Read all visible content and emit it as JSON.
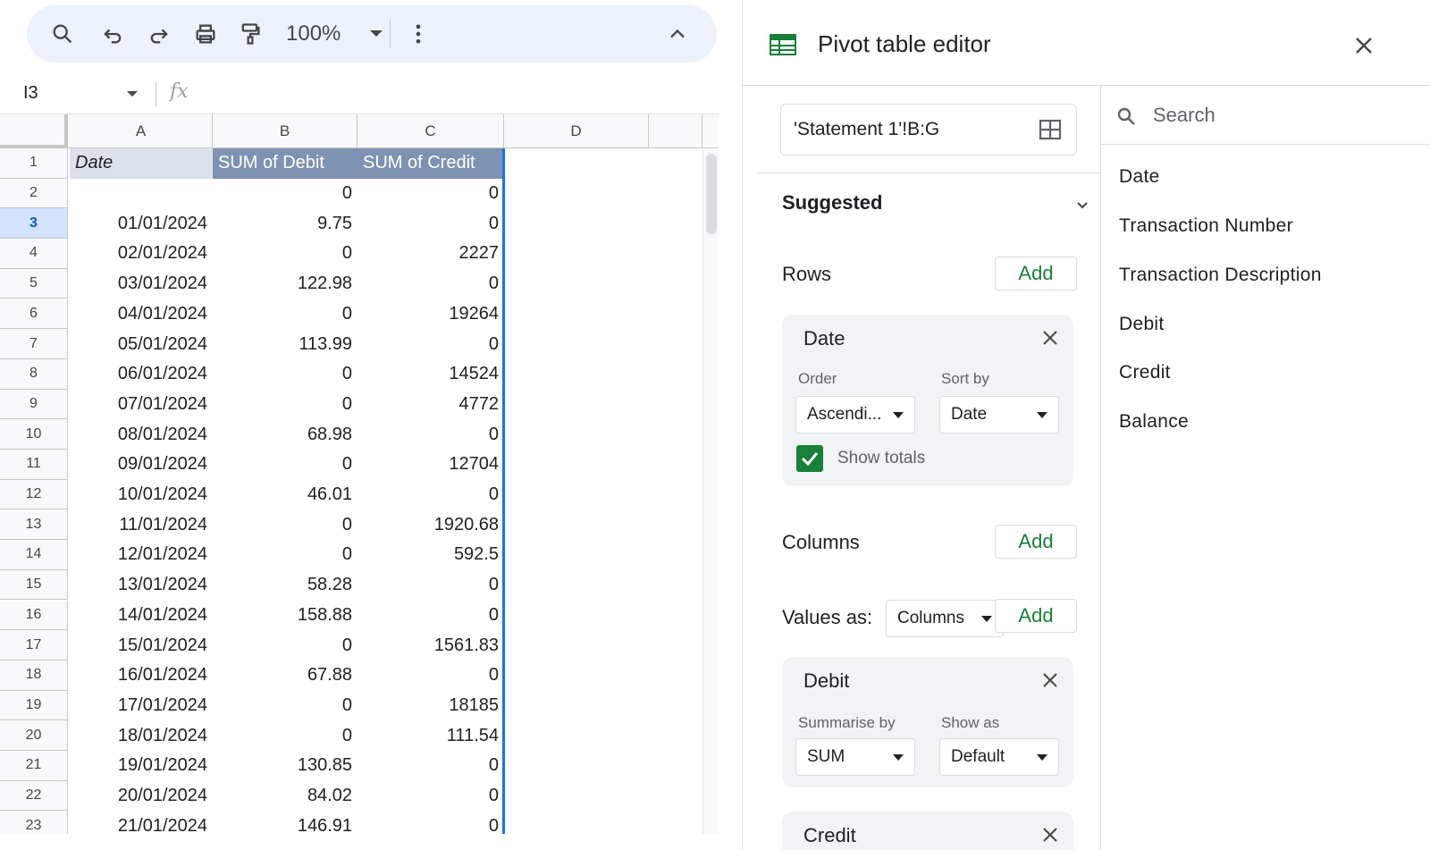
{
  "toolbar": {
    "zoom": "100%",
    "icons": [
      "search-icon",
      "undo-icon",
      "redo-icon",
      "print-icon",
      "paint-format-icon",
      "more-vert-icon",
      "chevron-up-icon"
    ]
  },
  "formula_bar": {
    "cell_ref": "I3",
    "fx": "fx"
  },
  "grid": {
    "columns": [
      "A",
      "B",
      "C",
      "D"
    ],
    "selected_row": "3",
    "header": {
      "row": "1",
      "a": "Date",
      "b": "SUM of Debit",
      "c": "SUM of Credit"
    },
    "rows": [
      {
        "num": "2",
        "a": "",
        "b": "0",
        "c": "0"
      },
      {
        "num": "3",
        "a": "01/01/2024",
        "b": "9.75",
        "c": "0"
      },
      {
        "num": "4",
        "a": "02/01/2024",
        "b": "0",
        "c": "2227"
      },
      {
        "num": "5",
        "a": "03/01/2024",
        "b": "122.98",
        "c": "0"
      },
      {
        "num": "6",
        "a": "04/01/2024",
        "b": "0",
        "c": "19264"
      },
      {
        "num": "7",
        "a": "05/01/2024",
        "b": "113.99",
        "c": "0"
      },
      {
        "num": "8",
        "a": "06/01/2024",
        "b": "0",
        "c": "14524"
      },
      {
        "num": "9",
        "a": "07/01/2024",
        "b": "0",
        "c": "4772"
      },
      {
        "num": "10",
        "a": "08/01/2024",
        "b": "68.98",
        "c": "0"
      },
      {
        "num": "11",
        "a": "09/01/2024",
        "b": "0",
        "c": "12704"
      },
      {
        "num": "12",
        "a": "10/01/2024",
        "b": "46.01",
        "c": "0"
      },
      {
        "num": "13",
        "a": "11/01/2024",
        "b": "0",
        "c": "1920.68"
      },
      {
        "num": "14",
        "a": "12/01/2024",
        "b": "0",
        "c": "592.5"
      },
      {
        "num": "15",
        "a": "13/01/2024",
        "b": "58.28",
        "c": "0"
      },
      {
        "num": "16",
        "a": "14/01/2024",
        "b": "158.88",
        "c": "0"
      },
      {
        "num": "17",
        "a": "15/01/2024",
        "b": "0",
        "c": "1561.83"
      },
      {
        "num": "18",
        "a": "16/01/2024",
        "b": "67.88",
        "c": "0"
      },
      {
        "num": "19",
        "a": "17/01/2024",
        "b": "0",
        "c": "18185"
      },
      {
        "num": "20",
        "a": "18/01/2024",
        "b": "0",
        "c": "111.54"
      },
      {
        "num": "21",
        "a": "19/01/2024",
        "b": "130.85",
        "c": "0"
      },
      {
        "num": "22",
        "a": "20/01/2024",
        "b": "84.02",
        "c": "0"
      },
      {
        "num": "23",
        "a": "21/01/2024",
        "b": "146.91",
        "c": "0"
      }
    ]
  },
  "editor": {
    "title": "Pivot table editor",
    "range": "'Statement 1'!B:G",
    "suggested": "Suggested",
    "rows_label": "Rows",
    "columns_label": "Columns",
    "values_as_label": "Values as:",
    "values_as_value": "Columns",
    "add_label": "Add",
    "row_card": {
      "title": "Date",
      "order_label": "Order",
      "order_value": "Ascendi...",
      "sort_by_label": "Sort by",
      "sort_by_value": "Date",
      "show_totals": "Show totals"
    },
    "value_card": {
      "title": "Debit",
      "summarise_label": "Summarise by",
      "summarise_value": "SUM",
      "show_as_label": "Show as",
      "show_as_value": "Default"
    },
    "next_card_title": "Credit",
    "search_placeholder": "Search",
    "fields": [
      "Date",
      "Transaction Number",
      "Transaction Description",
      "Debit",
      "Credit",
      "Balance"
    ]
  },
  "colors": {
    "pivot_header": "#7e93b2",
    "date_header": "#dce1ea",
    "accent_green": "#188038",
    "selection_blue": "#1a73e8"
  }
}
